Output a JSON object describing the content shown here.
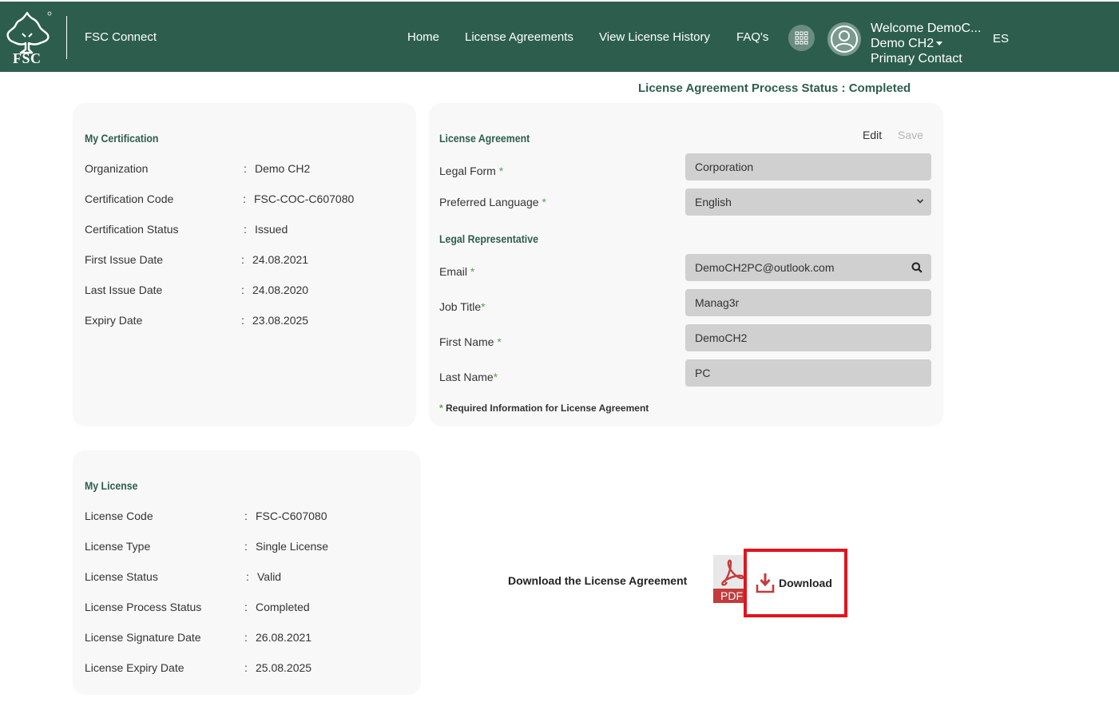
{
  "header": {
    "app_name": "FSC Connect",
    "logo_text": "FSC",
    "nav": [
      "Home",
      "License Agreements",
      "View License History",
      "FAQ's"
    ],
    "user": {
      "welcome": "Welcome DemoC...",
      "name": "Demo CH2",
      "role": "Primary Contact"
    },
    "language": "ES"
  },
  "process_status": "License Agreement Process Status : Completed",
  "certification": {
    "title": "My Certification",
    "rows": [
      {
        "label": "Organization",
        "value": "Demo CH2"
      },
      {
        "label": "Certification Code",
        "value": "FSC-COC-C607080"
      },
      {
        "label": "Certification Status",
        "value": "Issued"
      },
      {
        "label": "First Issue Date",
        "value": "24.08.2021"
      },
      {
        "label": "Last Issue Date",
        "value": "24.08.2020"
      },
      {
        "label": "Expiry Date",
        "value": "23.08.2025"
      }
    ]
  },
  "license_agreement": {
    "title": "License Agreement",
    "edit_label": "Edit",
    "save_label": "Save",
    "legal_form": {
      "label": "Legal Form",
      "value": "Corporation"
    },
    "preferred_language": {
      "label": "Preferred Language",
      "value": "English"
    },
    "legal_rep_title": "Legal Representative",
    "email": {
      "label": "Email",
      "value": "DemoCH2PC@outlook.com"
    },
    "job_title": {
      "label": "Job Title",
      "value": "Manag3r"
    },
    "first_name": {
      "label": "First Name",
      "value": "DemoCH2"
    },
    "last_name": {
      "label": "Last Name",
      "value": "PC"
    },
    "required_note": "Required Information for License Agreement"
  },
  "license": {
    "title": "My License",
    "rows": [
      {
        "label": "License Code",
        "value": "FSC-C607080"
      },
      {
        "label": "License Type",
        "value": "Single License"
      },
      {
        "label": "License Status",
        "value": "Valid"
      },
      {
        "label": "License Process Status",
        "value": "Completed"
      },
      {
        "label": "License Signature Date",
        "value": "26.08.2021"
      },
      {
        "label": "License Expiry Date",
        "value": "25.08.2025"
      }
    ]
  },
  "download": {
    "label": "Download the License Agreement",
    "pdf_text": "PDF",
    "button_label": "Download"
  },
  "colors": {
    "brand_green": "#2d5e4d",
    "required_green": "#57a05a",
    "highlight_red": "#e0141e",
    "pdf_red": "#c43b3b"
  },
  "icons": [
    "fsc-tree-logo",
    "apps-grid-icon",
    "user-avatar-icon",
    "caret-down-icon",
    "chevron-down-icon",
    "search-icon",
    "pdf-icon",
    "download-icon"
  ]
}
